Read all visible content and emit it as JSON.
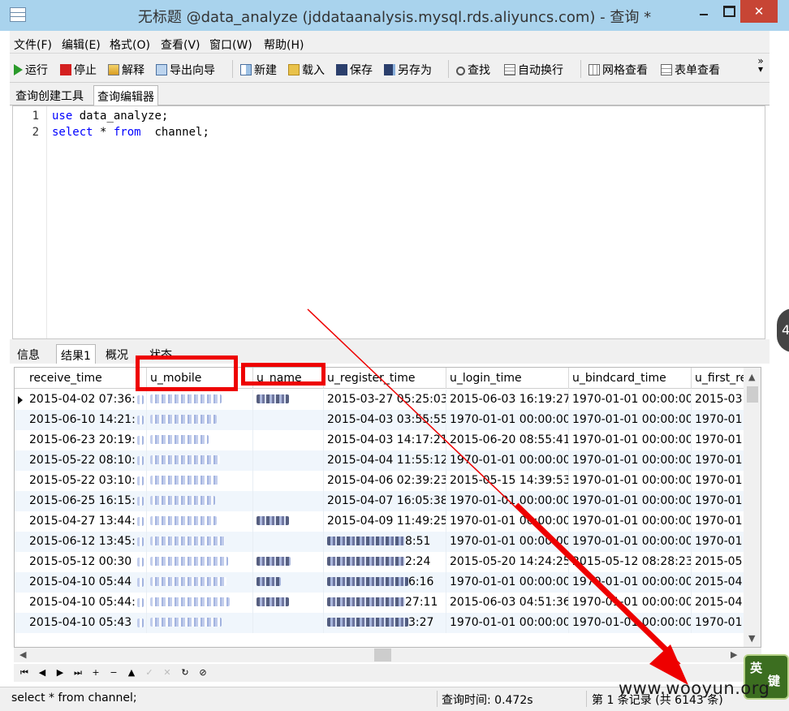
{
  "window": {
    "title": "无标题 @data_analyze (jddataanalysis.mysql.rds.aliyuncs.com) - 查询 *",
    "close_glyph": "✕"
  },
  "menu": [
    "文件(F)",
    "编辑(E)",
    "格式(O)",
    "查看(V)",
    "窗口(W)",
    "帮助(H)"
  ],
  "toolbar": {
    "run": "运行",
    "stop": "停止",
    "explain": "解释",
    "export_wizard": "导出向导",
    "new": "新建",
    "load": "载入",
    "save": "保存",
    "save_as": "另存为",
    "find": "查找",
    "word_wrap": "自动换行",
    "grid_view": "网格查看",
    "form_view": "表单查看",
    "more": "»"
  },
  "subtabs": [
    "查询创建工具",
    "查询编辑器"
  ],
  "editor": {
    "lines": [
      {
        "no": "1",
        "kw1": "use",
        "rest1": " data_analyze;",
        "kw2": "",
        "rest2": "",
        "kw3": "",
        "rest3": ""
      },
      {
        "no": "2",
        "kw1": "select",
        "rest1": " * ",
        "kw2": "from",
        "rest2": "  channel;",
        "kw3": "",
        "rest3": ""
      }
    ]
  },
  "result_tabs": [
    "信息",
    "结果1",
    "概况",
    "状态"
  ],
  "grid": {
    "columns": [
      "receive_time",
      "u_mobile",
      "u_name",
      "u_register_time",
      "u_login_time",
      "u_bindcard_time",
      "u_first_re"
    ],
    "rows": [
      [
        "2015-04-02 07:36:",
        "",
        "",
        "2015-03-27 05:25:03",
        "2015-06-03 16:19:27",
        "1970-01-01 00:00:00",
        "2015-03"
      ],
      [
        "2015-06-10 14:21:",
        "",
        "",
        "2015-04-03 03:55:55",
        "1970-01-01 00:00:00",
        "1970-01-01 00:00:00",
        "1970-01"
      ],
      [
        "2015-06-23 20:19:",
        "",
        "",
        "2015-04-03 14:17:21",
        "2015-06-20 08:55:41",
        "1970-01-01 00:00:00",
        "1970-01"
      ],
      [
        "2015-05-22 08:10:",
        "",
        "",
        "2015-04-04 11:55:12",
        "1970-01-01 00:00:00",
        "1970-01-01 00:00:00",
        "1970-01"
      ],
      [
        "2015-05-22 03:10:",
        "",
        "",
        "2015-04-06 02:39:23",
        "2015-05-15 14:39:53",
        "1970-01-01 00:00:00",
        "1970-01"
      ],
      [
        "2015-06-25 16:15:",
        "",
        "",
        "2015-04-07 16:05:38",
        "1970-01-01 00:00:00",
        "1970-01-01 00:00:00",
        "1970-01"
      ],
      [
        "2015-04-27 13:44:",
        "",
        "",
        "2015-04-09 11:49:25",
        "1970-01-01 00:00:00",
        "1970-01-01 00:00:00",
        "1970-01"
      ],
      [
        "2015-06-12 13:45:",
        "",
        "",
        "8:51",
        "1970-01-01 00:00:00",
        "1970-01-01 00:00:00",
        "1970-01"
      ],
      [
        "2015-05-12 00:30",
        "",
        "",
        "2:24",
        "2015-05-20 14:24:25",
        "2015-05-12 08:28:23",
        "2015-05"
      ],
      [
        "2015-04-10 05:44",
        "",
        "",
        "6:16",
        "1970-01-01 00:00:00",
        "1970-01-01 00:00:00",
        "2015-04"
      ],
      [
        "2015-04-10 05:44:",
        "",
        "",
        "27:11",
        "2015-06-03 04:51:36",
        "1970-01-01 00:00:00",
        "2015-04"
      ],
      [
        "2015-04-10 05:43",
        "",
        "",
        "3:27",
        "1970-01-01 00:00:00",
        "1970-01-01 00:00:00",
        "1970-01"
      ]
    ]
  },
  "navbar": [
    "⏮",
    "◀",
    "▶",
    "⏭",
    "+",
    "−",
    "▲",
    "✓",
    "✕",
    "↻",
    "⊘"
  ],
  "status": {
    "sql": "select * from  channel;",
    "query_time": "查询时间: 0.472s",
    "record": "第 1 条记录 (共 6143 条)"
  },
  "overlay": {
    "badge": "4",
    "ime_1": "英",
    "ime_2": "键",
    "watermark": "www.wooyun.org"
  },
  "colors": {
    "highlight": "#ee0000",
    "keyword": "#0000ff",
    "titlebar": "#a9d3ed",
    "close": "#c74535"
  }
}
